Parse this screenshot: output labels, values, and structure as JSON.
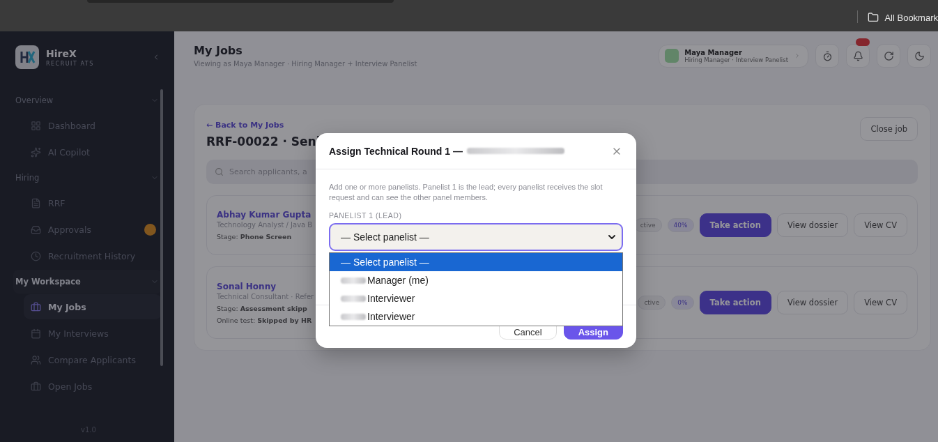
{
  "browser": {
    "bookmarks_label": "All Bookmark"
  },
  "sidebar": {
    "brand": "HireX",
    "tagline": "RECRUIT ATS",
    "version": "v1.0",
    "sections": [
      {
        "title": "Overview",
        "expanded": true,
        "selected": false,
        "items": [
          {
            "label": "Dashboard",
            "selected": false
          },
          {
            "label": "AI Copilot",
            "selected": false
          }
        ]
      },
      {
        "title": "Hiring",
        "expanded": true,
        "selected": false,
        "items": [
          {
            "label": "RRF",
            "selected": false
          },
          {
            "label": "Approvals",
            "selected": false,
            "badge": true
          },
          {
            "label": "Recruitment History",
            "selected": false
          }
        ]
      },
      {
        "title": "My Workspace",
        "expanded": true,
        "selected": true,
        "items": [
          {
            "label": "My Jobs",
            "selected": true
          },
          {
            "label": "My Interviews",
            "selected": false
          },
          {
            "label": "Compare Applicants",
            "selected": false
          },
          {
            "label": "Open Jobs",
            "selected": false
          }
        ]
      }
    ]
  },
  "header": {
    "title": "My Jobs",
    "subtitle": "Viewing as Maya Manager · Hiring Manager + Interview Panelist",
    "user": {
      "name": "Maya Manager",
      "role": "Hiring Manager · Interview Panelist"
    },
    "notifications_badge": true
  },
  "job": {
    "back_link": "← Back to My Jobs",
    "title": "RRF-00022 · Seni",
    "close_button": "Close job",
    "search_placeholder": "Search applicants, a",
    "applicants": [
      {
        "name": "Abhay Kumar Gupta",
        "role": "Technology Analyst / Java B",
        "stage_label": "Stage:",
        "stage": "Phone Screen",
        "status": "ctive",
        "score": "40%",
        "actions": [
          "Take action",
          "View dossier",
          "View CV"
        ]
      },
      {
        "name": "Sonal Honny",
        "role": "Technical Consultant · Refer",
        "stage_label": "Stage:",
        "stage": "Assessment skipp",
        "note_label": "Online test:",
        "note": "Skipped by HR",
        "status": "ctive",
        "score": "0%",
        "actions": [
          "Take action",
          "View dossier",
          "View CV"
        ]
      }
    ]
  },
  "modal": {
    "title": "Assign Technical Round 1 —",
    "description": "Add one or more panelists. Panelist 1 is the lead; every panelist receives the slot request and can see the other panel members.",
    "field_label": "PANELIST 1 (LEAD)",
    "select_value": "— Select panelist —",
    "dropdown_open": true,
    "options": [
      {
        "label": "— Select panelist —",
        "selected": true,
        "redacted": false
      },
      {
        "label": "Manager (me)",
        "selected": false,
        "redacted": true
      },
      {
        "label": "Interviewer",
        "selected": false,
        "redacted": true
      },
      {
        "label": "Interviewer",
        "selected": false,
        "redacted": true
      }
    ],
    "buttons": [
      {
        "label": "Cancel",
        "kind": "secondary"
      },
      {
        "label": "Assign",
        "kind": "primary"
      }
    ]
  }
}
